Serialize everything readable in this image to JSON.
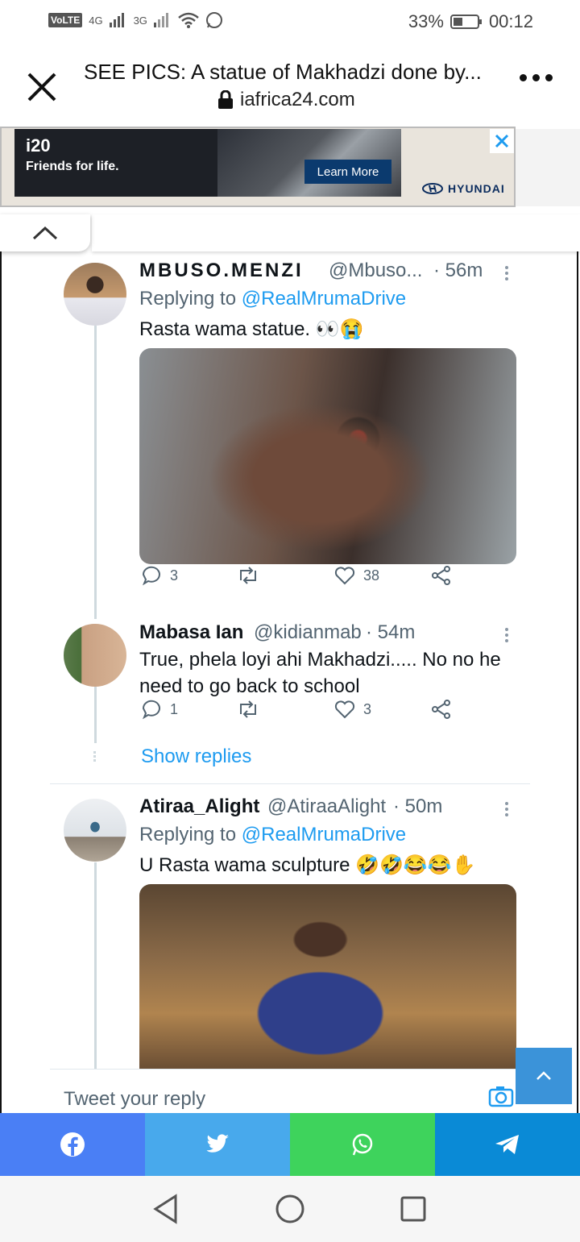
{
  "status_bar": {
    "volte": "VoLTE",
    "net1": "4G",
    "net2": "3G",
    "battery": "33%",
    "time": "00:12"
  },
  "browser": {
    "title": "SEE PICS: A statue of Makhadzi done by...",
    "domain": "iafrica24.com"
  },
  "ad": {
    "model": "i20",
    "tagline": "Friends for life.",
    "cta": "Learn More",
    "brand": "HYUNDAI"
  },
  "tweets": [
    {
      "name": "MBUSO.MENZI",
      "handle": "@Mbuso...",
      "time": "· 56m",
      "replying_label": "Replying to",
      "replying_to": "@RealMrumaDrive",
      "text": "Rasta wama statue. 👀😭",
      "replies": "3",
      "likes": "38"
    },
    {
      "name": "Mabasa Ian",
      "handle": "@kidianmab",
      "time": "· 54m",
      "text": "True, phela loyi ahi Makhadzi..... No no he need to go back to school",
      "replies": "1",
      "likes": "3",
      "show_replies": "Show replies"
    },
    {
      "name": "Atiraa_Alight",
      "handle": "@AtiraaAlight",
      "time": "· 50m",
      "replying_label": "Replying to",
      "replying_to": "@RealMrumaDrive",
      "text": "U Rasta wama sculpture 🤣🤣😂😂✋"
    }
  ],
  "reply_placeholder": "Tweet your reply",
  "share_colors": [
    "#4a7ff5",
    "#48a9ec",
    "#3ed35c",
    "#0a8ad6"
  ]
}
